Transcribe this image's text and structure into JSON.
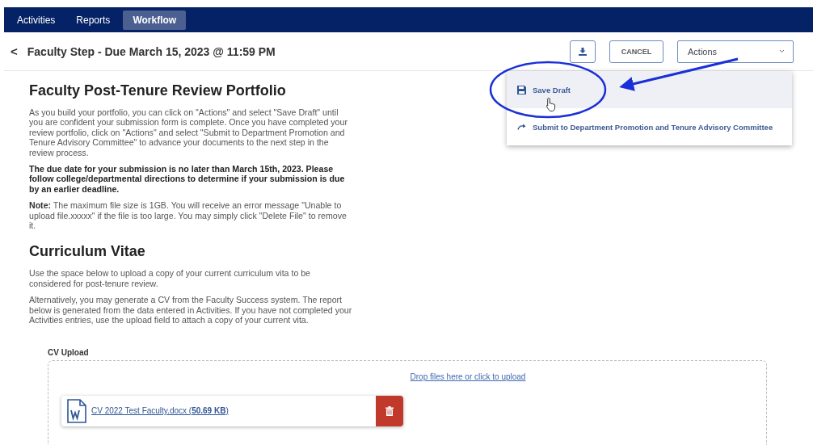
{
  "nav": {
    "tabs": [
      {
        "label": "Activities",
        "selected": false
      },
      {
        "label": "Reports",
        "selected": false
      },
      {
        "label": "Workflow",
        "selected": true
      }
    ]
  },
  "header": {
    "back": "<",
    "title": "Faculty Step - Due March 15, 2023 @ 11:59 PM",
    "cancel": "CANCEL",
    "actions": "Actions"
  },
  "actions_menu": {
    "items": [
      {
        "label": "Save Draft",
        "kind": "save",
        "selected": true
      },
      {
        "label": "Submit to Department Promotion and Tenure Advisory Committee",
        "kind": "submit",
        "selected": false
      }
    ]
  },
  "sections": [
    {
      "heading": "Faculty Post-Tenure Review Portfolio",
      "paragraphs": [
        {
          "kind": "plain",
          "text": "As you build your portfolio, you can click on \"Actions\" and select \"Save Draft\" until you are confident your submission form is complete. Once you have completed your review portfolio, click on \"Actions\" and select \"Submit to Department Promotion and Tenure Advisory Committee\" to advance your documents to the next step in the review process."
        },
        {
          "kind": "bold",
          "text": "The due date for your submission is no later than March 15th, 2023.  Please follow college/departmental directions to determine if your submission is due by an earlier deadline."
        },
        {
          "kind": "plain",
          "text": "**Note:** The maximum file size is 1GB. You will receive an error message \"Unable to upload file.xxxxx\" if the file is too large. You may simply click \"Delete File\" to remove it."
        }
      ]
    },
    {
      "heading": "Curriculum Vitae",
      "paragraphs": [
        {
          "kind": "plain",
          "text": "Use the space below to upload a copy of your current curriculum vita to be considered for post-tenure review."
        },
        {
          "kind": "plain",
          "text": "Alternatively, you may generate a CV from the Faculty Success system. The report below is generated from the data entered in Activities. If you have not completed your Activities entries, use the upload field to attach a copy of your current vita."
        }
      ]
    }
  ],
  "upload": {
    "label": "CV Upload",
    "drop_text": "Drop files here or click to upload",
    "files": [
      {
        "name": "CV 2022 Test Faculty.docx (**50.69 KB**)"
      }
    ]
  }
}
